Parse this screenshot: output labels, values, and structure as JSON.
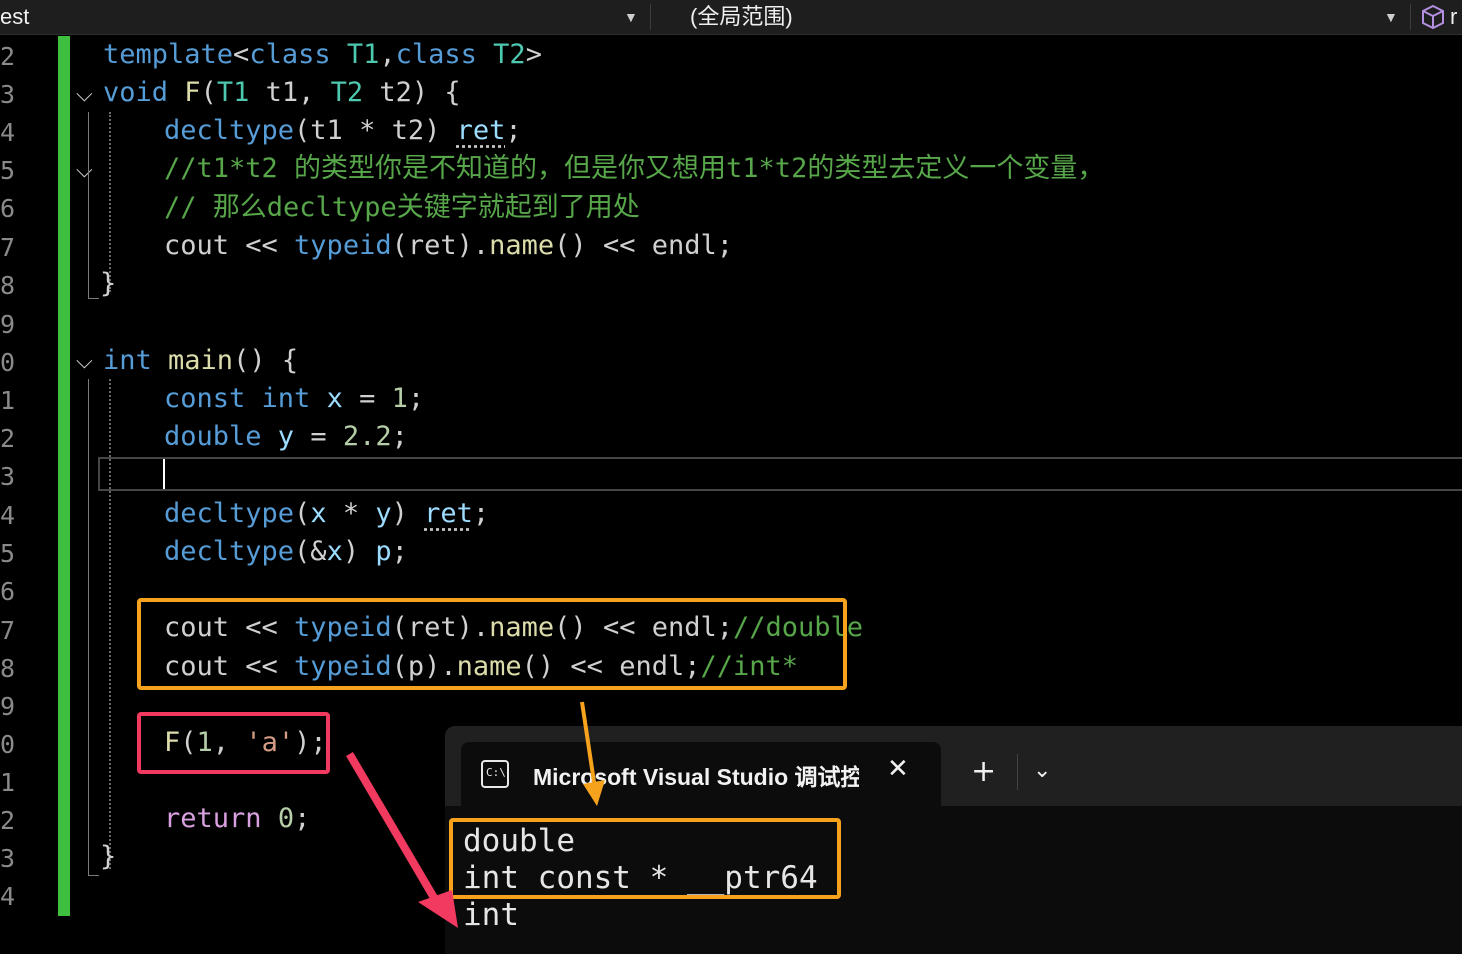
{
  "toolbar": {
    "project_combo": "est",
    "scope_combo": "(全局范围)",
    "member_combo_partial": "r"
  },
  "line_numbers": [
    "2",
    "3",
    "4",
    "5",
    "6",
    "7",
    "8",
    "9",
    "0",
    "1",
    "2",
    "3",
    "4",
    "5",
    "6",
    "7",
    "8",
    "9",
    "0",
    "1",
    "2",
    "3",
    "4"
  ],
  "code": {
    "l1": {
      "kw1": "template",
      "p1": "<",
      "kw2": "class",
      "t1": " T1",
      "p2": ",",
      "kw3": "class",
      "t2": " T2",
      "p3": ">"
    },
    "l2": {
      "kw": "void",
      "fn": " F",
      "p1": "(",
      "t1": "T1",
      "a1": " t1, ",
      "t2": "T2",
      "a2": " t2) {"
    },
    "l3": {
      "kw": "decltype",
      "p1": "(t1 * t2) ",
      "v": "ret",
      "p2": ";"
    },
    "l4": {
      "cm": "//t1*t2 的类型你是不知道的，但是你又想用t1*t2的类型去定义一个变量，"
    },
    "l5": {
      "cm": "// 那么decltype关键字就起到了用处"
    },
    "l6": {
      "a": "cout << ",
      "kw": "typeid",
      "p": "(ret).",
      "fn": "name",
      "b": "() << endl;"
    },
    "l7": {
      "a": "}"
    },
    "l9": {
      "kw": "int",
      "fn": " main",
      "b": "() {"
    },
    "l10": {
      "kw1": "const",
      "kw2": " int",
      "v": " x",
      "b": " = ",
      "n": "1",
      "e": ";"
    },
    "l11": {
      "kw": "double",
      "v": " y",
      "b": " = ",
      "n": "2.2",
      "e": ";"
    },
    "l13": {
      "kw": "decltype",
      "p": "(",
      "v1": "x",
      "op": " * ",
      "v2": "y",
      "p2": ") ",
      "v3": "ret",
      "e": ";"
    },
    "l14": {
      "kw": "decltype",
      "p": "(&",
      "v1": "x",
      "p2": ") ",
      "v3": "p",
      "e": ";"
    },
    "l16": {
      "a": "cout << ",
      "kw": "typeid",
      "p": "(ret).",
      "fn": "name",
      "b": "() << endl;",
      "cm": "//double"
    },
    "l17": {
      "a": "cout << ",
      "kw": "typeid",
      "p": "(p).",
      "fn": "name",
      "b": "() << endl;",
      "cm": "//int*"
    },
    "l19": {
      "fn": "F",
      "p": "(",
      "n": "1",
      ",": ", ",
      "s": "'a'",
      "e": ");"
    },
    "l21": {
      "kw": "return",
      "b": " ",
      "n": "0",
      "e": ";"
    },
    "l22": {
      "a": "}"
    }
  },
  "terminal": {
    "tab_title": "Microsoft Visual Studio 调试控制台",
    "icon_text": "C:\\",
    "close_glyph": "✕",
    "new_tab_glyph": "+",
    "dropdown_glyph": "⌄",
    "output": [
      "double",
      "int const * __ptr64",
      "int"
    ]
  },
  "colors": {
    "highlight_orange": "#f6a21c",
    "highlight_red": "#f2395f",
    "change_bar_green": "#3fbf3f"
  }
}
